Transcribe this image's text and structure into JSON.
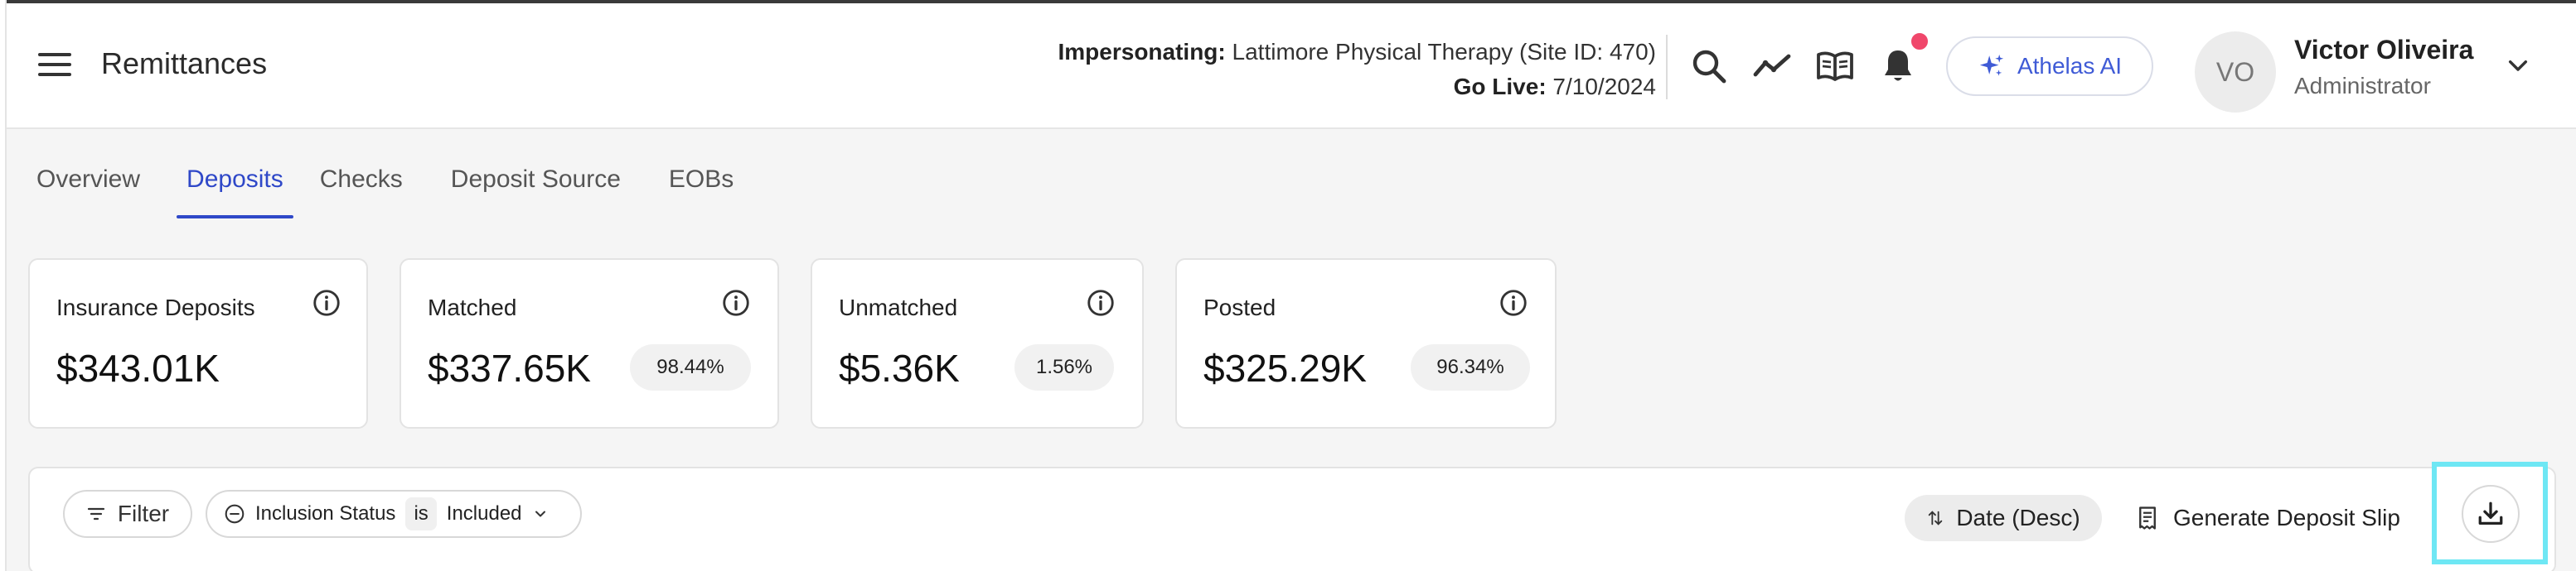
{
  "header": {
    "title": "Remittances",
    "impersonating_label": "Impersonating:",
    "impersonating_value": "Lattimore Physical Therapy (Site ID: 470)",
    "golive_label": "Go Live:",
    "golive_value": "7/10/2024",
    "ai_button_label": "Athelas AI",
    "user": {
      "initials": "VO",
      "name": "Victor Oliveira",
      "role": "Administrator"
    },
    "icons": [
      "menu-icon",
      "search-icon",
      "trend-icon",
      "book-icon",
      "bell-icon",
      "sparkle-icon",
      "chevron-down-icon"
    ],
    "accent_color": "#2f48c8",
    "notification_dot_color": "#f0476b"
  },
  "tabs": [
    {
      "label": "Overview",
      "active": false
    },
    {
      "label": "Deposits",
      "active": true
    },
    {
      "label": "Checks",
      "active": false
    },
    {
      "label": "Deposit Source",
      "active": false
    },
    {
      "label": "EOBs",
      "active": false
    }
  ],
  "cards": [
    {
      "title": "Insurance Deposits",
      "value": "$343.01K",
      "percent": ""
    },
    {
      "title": "Matched",
      "value": "$337.65K",
      "percent": "98.44%"
    },
    {
      "title": "Unmatched",
      "value": "$5.36K",
      "percent": "1.56%"
    },
    {
      "title": "Posted",
      "value": "$325.29K",
      "percent": "96.34%"
    }
  ],
  "toolbar": {
    "filter_label": "Filter",
    "chip_field": "Inclusion Status",
    "chip_operator": "is",
    "chip_value": "Included",
    "sort_label": "Date (Desc)",
    "slip_label": "Generate Deposit Slip",
    "highlight_color": "#6ee7f4"
  }
}
